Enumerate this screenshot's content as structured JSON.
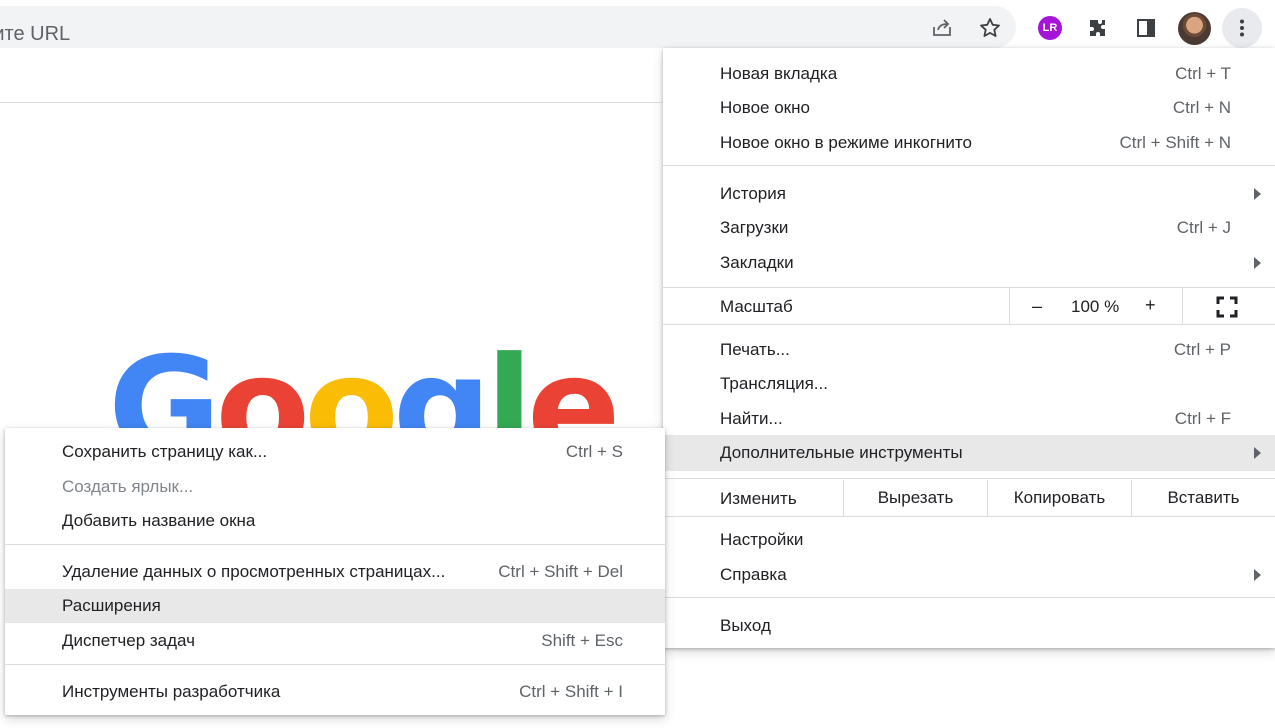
{
  "toolbar": {
    "omnibox_text": "жите URL",
    "share_icon": "share-icon",
    "bookmark_icon": "star-icon",
    "lr_icon_text": "LR",
    "extensions_icon": "puzzle-icon",
    "side_panel_icon": "side-panel-icon",
    "menu_icon": "three-dots-icon"
  },
  "google_logo": {
    "letters": [
      "G",
      "o",
      "o",
      "g",
      "l",
      "e"
    ],
    "colors": [
      "#4285f4",
      "#ea4335",
      "#fbbc05",
      "#4285f4",
      "#34a853",
      "#ea4335"
    ]
  },
  "main_menu": {
    "new_tab": {
      "label": "Новая вкладка",
      "shortcut": "Ctrl + T"
    },
    "new_window": {
      "label": "Новое окно",
      "shortcut": "Ctrl + N"
    },
    "incognito": {
      "label": "Новое окно в режиме инкогнито",
      "shortcut": "Ctrl + Shift + N"
    },
    "history": {
      "label": "История"
    },
    "downloads": {
      "label": "Загрузки",
      "shortcut": "Ctrl + J"
    },
    "bookmarks": {
      "label": "Закладки"
    },
    "zoom": {
      "label": "Масштаб",
      "minus": "–",
      "value": "100 %",
      "plus": "+"
    },
    "print": {
      "label": "Печать...",
      "shortcut": "Ctrl + P"
    },
    "cast": {
      "label": "Трансляция..."
    },
    "find": {
      "label": "Найти...",
      "shortcut": "Ctrl + F"
    },
    "more_tools": {
      "label": "Дополнительные инструменты"
    },
    "edit": {
      "label": "Изменить",
      "cut": "Вырезать",
      "copy": "Копировать",
      "paste": "Вставить"
    },
    "settings": {
      "label": "Настройки"
    },
    "help": {
      "label": "Справка"
    },
    "exit": {
      "label": "Выход"
    }
  },
  "sub_menu": {
    "save_page": {
      "label": "Сохранить страницу как...",
      "shortcut": "Ctrl + S"
    },
    "create_shortcut": {
      "label": "Создать ярлык..."
    },
    "name_window": {
      "label": "Добавить название окна"
    },
    "clear_data": {
      "label": "Удаление данных о просмотренных страницах...",
      "shortcut": "Ctrl + Shift + Del"
    },
    "extensions": {
      "label": "Расширения"
    },
    "task_manager": {
      "label": "Диспетчер задач",
      "shortcut": "Shift + Esc"
    },
    "dev_tools": {
      "label": "Инструменты разработчика",
      "shortcut": "Ctrl + Shift + I"
    }
  },
  "colors": {
    "highlight": "#e8e8e8",
    "text": "#202124",
    "secondary_text": "#5f6368"
  }
}
